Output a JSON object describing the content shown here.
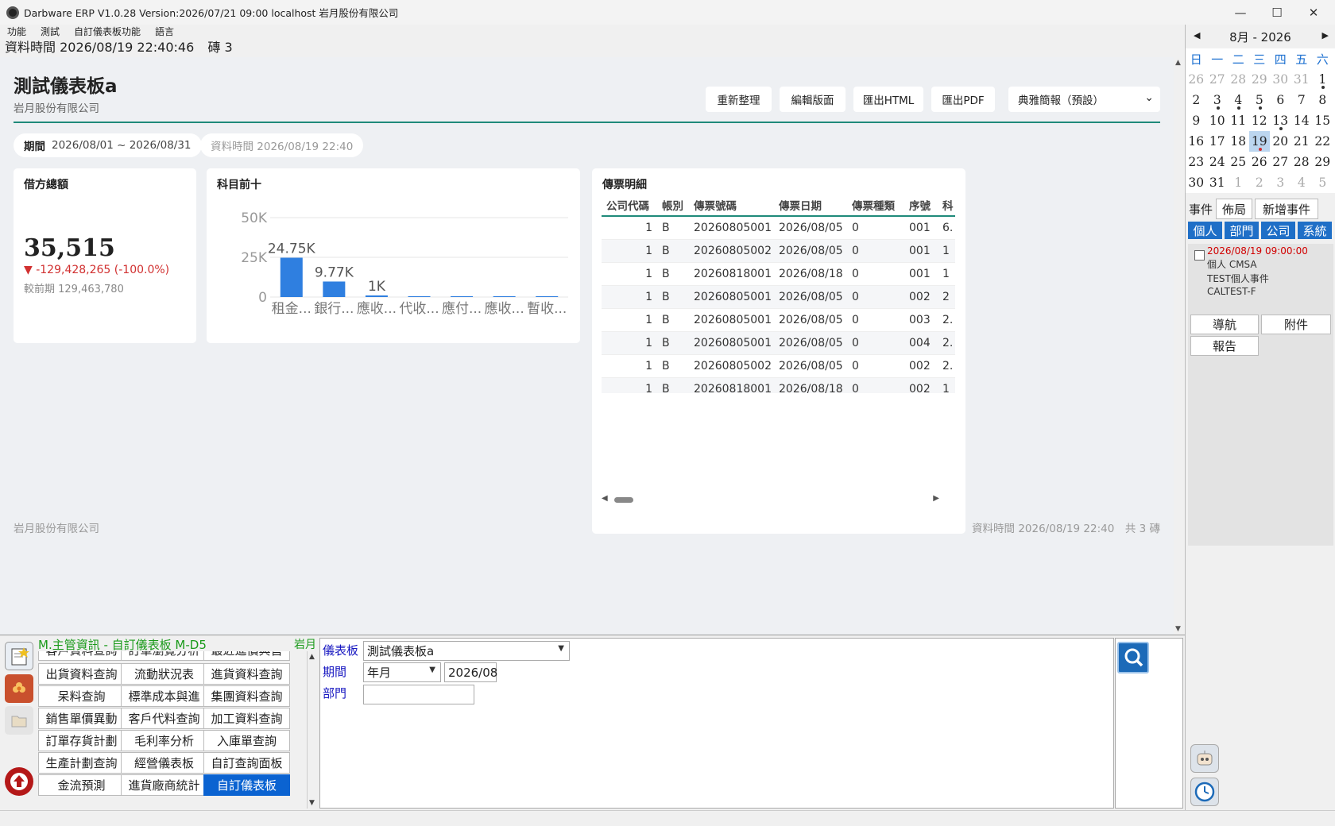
{
  "window": {
    "title": "Darbware ERP V1.0.28 Version:2026/07/21 09:00   localhost 岩月股份有限公司",
    "minimize": "—",
    "maximize": "☐",
    "close": "✕"
  },
  "menu": [
    "功能",
    "測試",
    "自訂儀表板功能",
    "語言"
  ],
  "infobar": {
    "data_time": "資料時間 2026/08/19 22:40:46",
    "count": "磚 3"
  },
  "dashboard": {
    "title": "測試儀表板a",
    "company": "岩月股份有限公司",
    "buttons": {
      "refresh": "重新整理",
      "edit": "編輯版面",
      "export_html": "匯出HTML",
      "export_pdf": "匯出PDF"
    },
    "theme_select": "典雅簡報（預設）",
    "period_label": "期間",
    "period_value": "2026/08/01 ~ 2026/08/31",
    "data_time_pill": "資料時間 2026/08/19 22:40",
    "debit_card": {
      "title": "借方總額",
      "value": "35,515",
      "delta": "▼ -129,428,265 (-100.0%)",
      "previous": "較前期 129,463,780"
    },
    "top10_card": {
      "title": "科目前十"
    },
    "voucher_card": {
      "title": "傳票明細",
      "columns": [
        "公司代碼",
        "帳別",
        "傳票號碼",
        "傳票日期",
        "傳票種類",
        "序號",
        "科"
      ],
      "rows": [
        [
          "1",
          "B",
          "20260805001",
          "2026/08/05",
          "0",
          "001",
          "6."
        ],
        [
          "1",
          "B",
          "20260805002",
          "2026/08/05",
          "0",
          "001",
          "1"
        ],
        [
          "1",
          "B",
          "20260818001",
          "2026/08/18",
          "0",
          "001",
          "1"
        ],
        [
          "1",
          "B",
          "20260805001",
          "2026/08/05",
          "0",
          "002",
          "2"
        ],
        [
          "1",
          "B",
          "20260805001",
          "2026/08/05",
          "0",
          "003",
          "2."
        ],
        [
          "1",
          "B",
          "20260805001",
          "2026/08/05",
          "0",
          "004",
          "2."
        ],
        [
          "1",
          "B",
          "20260805002",
          "2026/08/05",
          "0",
          "002",
          "2."
        ],
        [
          "1",
          "B",
          "20260818001",
          "2026/08/18",
          "0",
          "002",
          "1"
        ]
      ]
    },
    "footer_left": "岩月股份有限公司",
    "footer_right": "資料時間 2026/08/19 22:40　共 3 磚"
  },
  "chart_data": {
    "type": "bar",
    "categories": [
      "租金...",
      "銀行...",
      "應收...",
      "代收...",
      "應付...",
      "應收...",
      "暫收..."
    ],
    "values": [
      24750,
      9770,
      1000,
      0,
      0,
      0,
      0
    ],
    "value_labels": [
      "24.75K",
      "9.77K",
      "1K",
      "",
      "",
      "",
      ""
    ],
    "yticks": [
      "0",
      "25K",
      "50K"
    ],
    "ylim": [
      0,
      50000
    ],
    "color": "#2f7fe0",
    "grid": true,
    "legend": "none"
  },
  "calendar": {
    "month_label": "8月  -  2026",
    "weekdays": [
      "日",
      "一",
      "二",
      "三",
      "四",
      "五",
      "六"
    ],
    "weeks": [
      [
        "26",
        "27",
        "28",
        "29",
        "30",
        "31",
        "1"
      ],
      [
        "2",
        "3",
        "4",
        "5",
        "6",
        "7",
        "8"
      ],
      [
        "9",
        "10",
        "11",
        "12",
        "13",
        "14",
        "15"
      ],
      [
        "16",
        "17",
        "18",
        "19",
        "20",
        "21",
        "22"
      ],
      [
        "23",
        "24",
        "25",
        "26",
        "27",
        "28",
        "29"
      ],
      [
        "30",
        "31",
        "1",
        "2",
        "3",
        "4",
        "5"
      ]
    ],
    "today": "19",
    "tabs": {
      "events": "事件",
      "layout": "佈局",
      "new_event": "新增事件"
    },
    "filters": [
      "個人",
      "部門",
      "公司",
      "系統"
    ],
    "event": {
      "time": "2026/08/19 09:00:00",
      "scope": "個人  CMSA",
      "title": "TEST個人事件",
      "code": "CALTEST-F"
    },
    "actions": {
      "nav": "導航",
      "attach": "附件",
      "report": "報告"
    }
  },
  "function_panel": {
    "title": "M.主管資訊 - 自訂儀表板  M-D5",
    "right_label": "岩月",
    "partial_row": [
      "客戶資料查詢",
      "訂單瀏覽分析",
      "最近進價與售"
    ],
    "grid": [
      [
        "出貨資料查詢",
        "流動狀況表",
        "進貨資料查詢"
      ],
      [
        "呆料查詢",
        "標準成本與進",
        "集團資料查詢"
      ],
      [
        "銷售單價異動",
        "客戶代料查詢",
        "加工資料查詢"
      ],
      [
        "訂單存貨計劃",
        "毛利率分析",
        "入庫單查詢"
      ],
      [
        "生產計劃查詢",
        "經營儀表板",
        "自訂查詢面板"
      ],
      [
        "金流預測",
        "進貨廠商統計",
        "自訂儀表板"
      ]
    ],
    "selected": "自訂儀表板"
  },
  "params": {
    "dashboard_label": "儀表板",
    "dashboard_value": "測試儀表板a",
    "period_label": "期間",
    "period_type": "年月",
    "period_value": "2026/08",
    "dept_label": "部門",
    "dept_value": ""
  }
}
